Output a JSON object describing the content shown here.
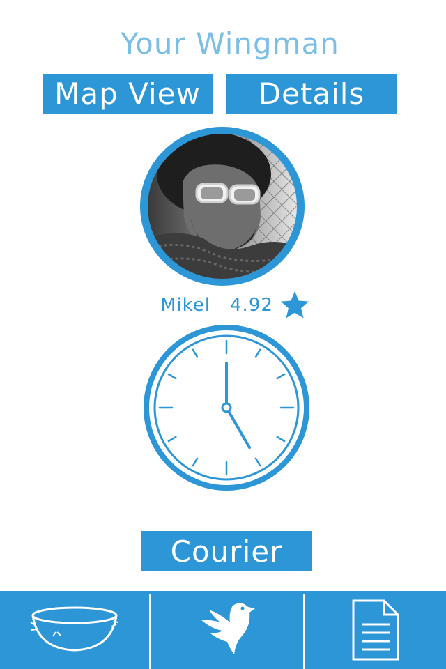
{
  "header": {
    "title": "Your Wingman"
  },
  "toolbar": {
    "map_view_label": "Map View",
    "details_label": "Details"
  },
  "driver": {
    "name": "Mikel",
    "rating": "4.92"
  },
  "clock": {
    "hour": 5,
    "minute": 0
  },
  "action": {
    "courier_label": "Courier"
  },
  "tabbar": {
    "items": [
      {
        "icon": "bowl-icon"
      },
      {
        "icon": "bird-icon"
      },
      {
        "icon": "document-icon"
      }
    ]
  },
  "colors": {
    "accent": "#2d96d6",
    "title": "#7cbfe6",
    "background": "#ffffff"
  }
}
